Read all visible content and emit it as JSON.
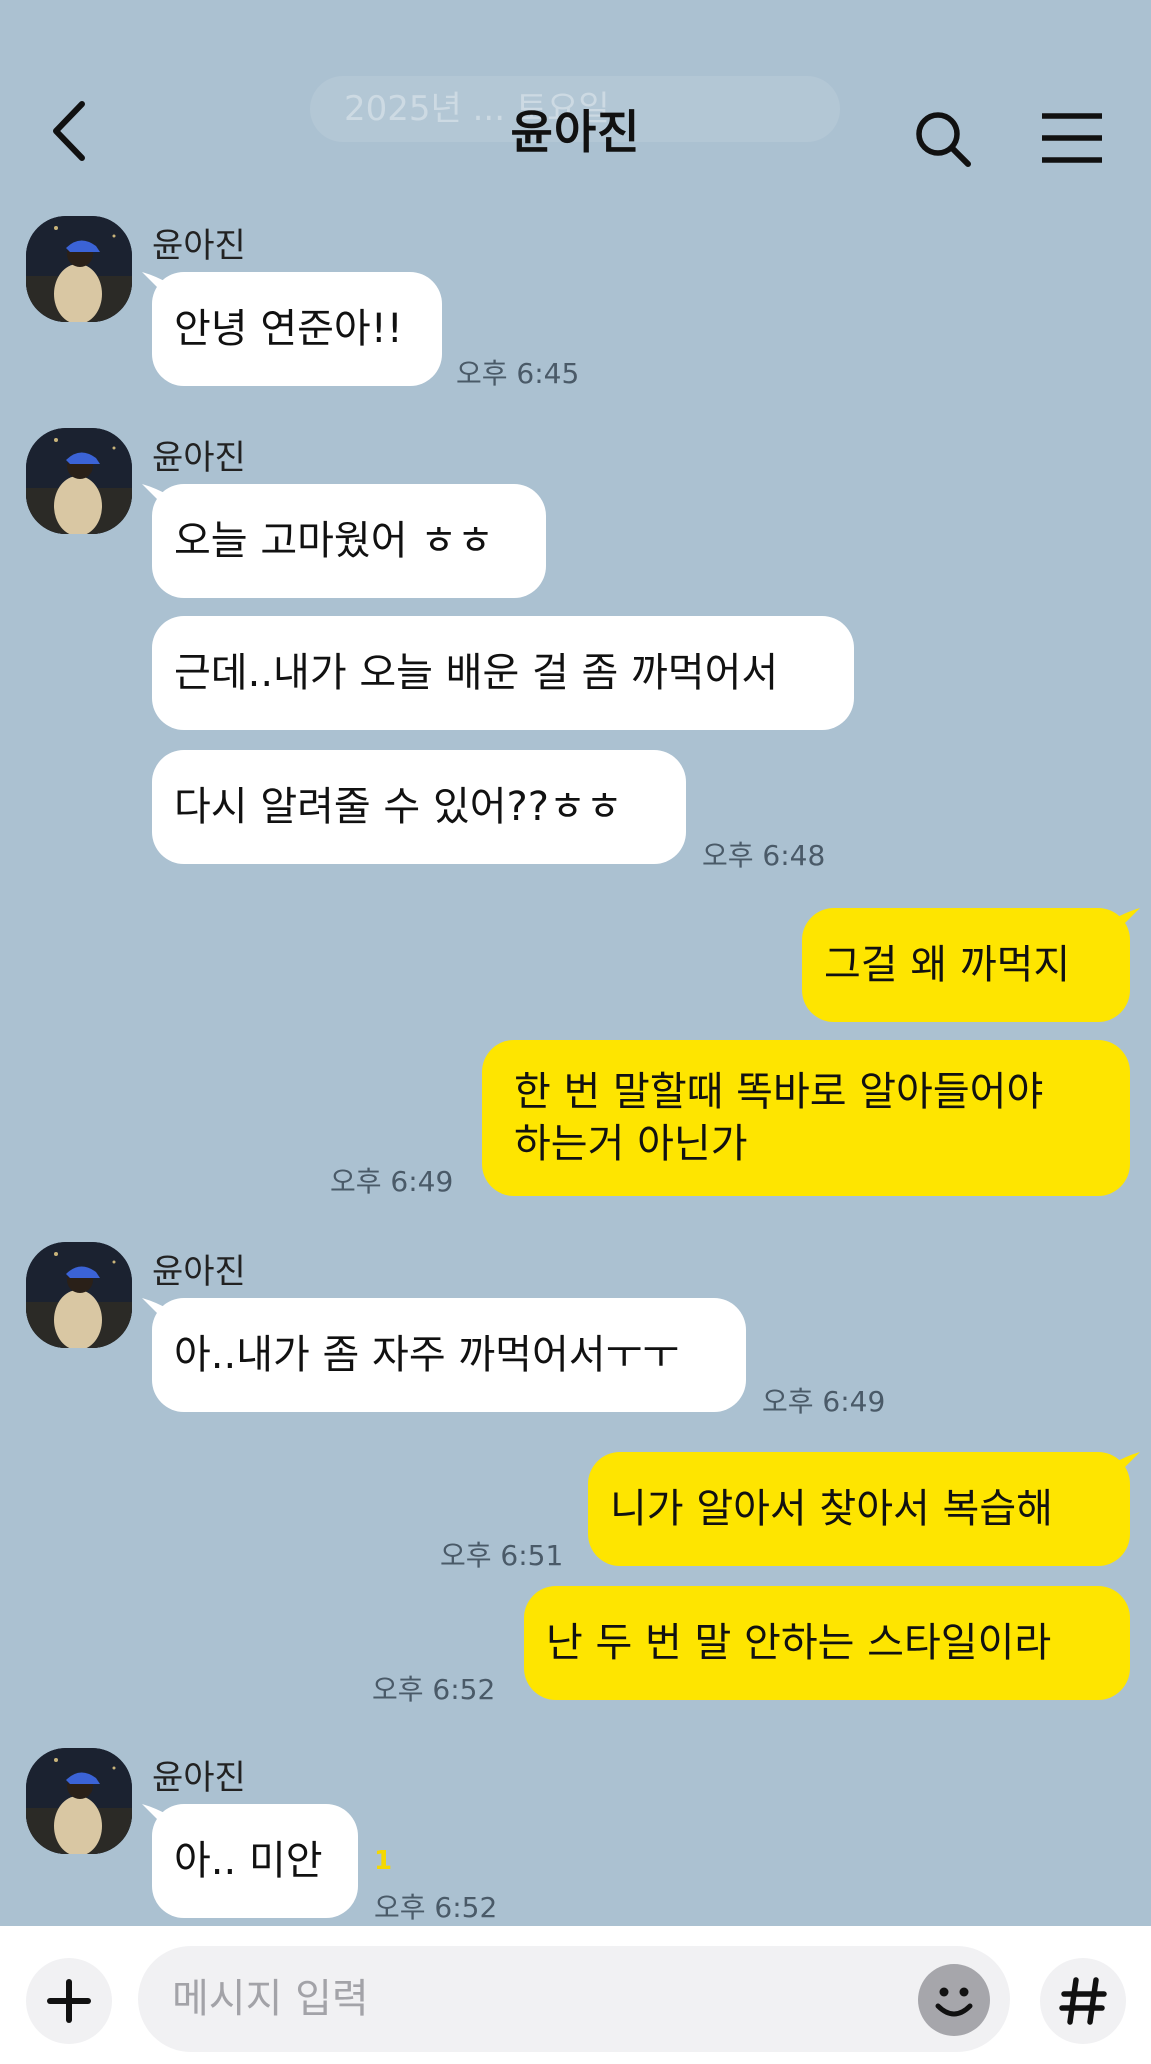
{
  "header": {
    "title": "윤아진",
    "date_pill": "2025년 ... 토요일"
  },
  "input": {
    "placeholder": "메시지 입력"
  },
  "messages": [
    {
      "sender": "윤아진",
      "text": "안녕 연준아!!",
      "time": "오후 6:45"
    },
    {
      "sender": "윤아진",
      "text": "오늘 고마웠어 ㅎㅎ"
    },
    {
      "text": "근데..내가 오늘 배운 걸 좀 까먹어서"
    },
    {
      "text": "다시 알려줄 수 있어??ㅎㅎ",
      "time": "오후 6:48"
    },
    {
      "text": "그걸 왜 까먹지"
    },
    {
      "text_line1": "한 번 말할때 똑바로 알아들어야",
      "text_line2": "하는거 아닌가",
      "time": "오후 6:49"
    },
    {
      "sender": "윤아진",
      "text": "아..내가 좀 자주 까먹어서ㅜㅜ",
      "time": "오후 6:49"
    },
    {
      "text": "니가 알아서 찾아서 복습해",
      "time": "오후 6:51"
    },
    {
      "text": "난 두 번 말 안하는 스타일이라",
      "time": "오후 6:52"
    },
    {
      "sender": "윤아진",
      "text": "아.. 미안",
      "time": "오후 6:52",
      "unread": "1"
    }
  ],
  "colors": {
    "background": "#abc1d1",
    "incoming_bubble": "#ffffff",
    "outgoing_bubble": "#fee500"
  }
}
